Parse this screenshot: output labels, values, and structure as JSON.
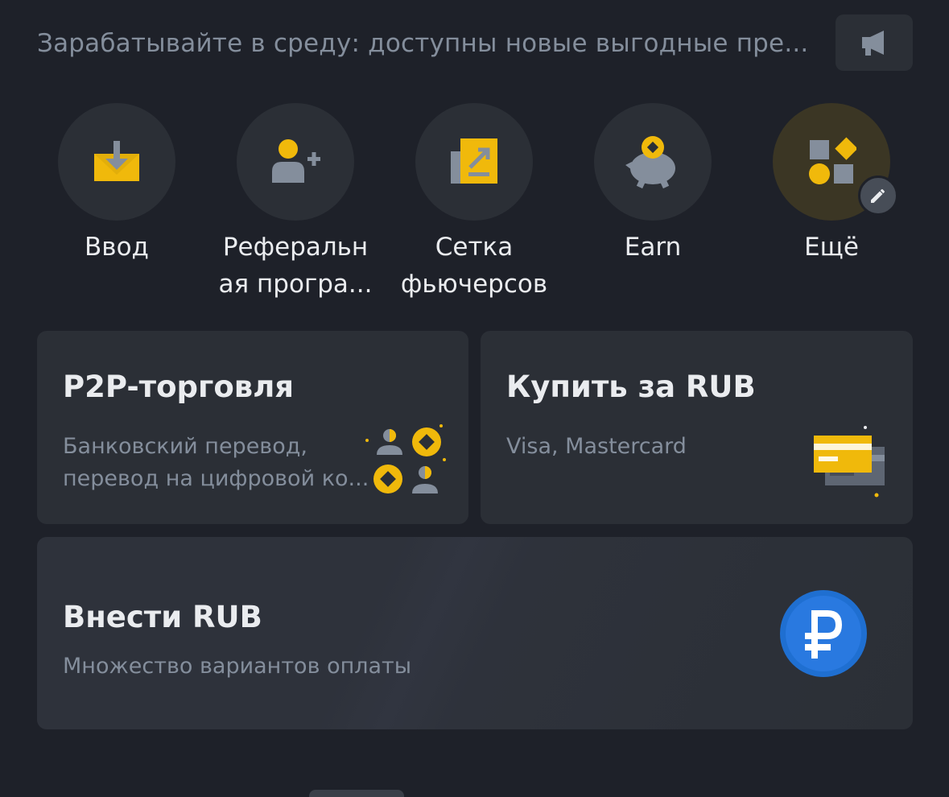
{
  "announcement": {
    "text": "Зарабатывайте в среду: доступны новые выгодные пре...",
    "icon": "megaphone-icon"
  },
  "shortcuts": [
    {
      "label": "Ввод",
      "icon": "deposit-icon"
    },
    {
      "label": "Реферальн\nая програ...",
      "icon": "referral-icon"
    },
    {
      "label": "Сетка\nфьючерсов",
      "icon": "futures-grid-icon"
    },
    {
      "label": "Earn",
      "icon": "earn-piggy-icon"
    },
    {
      "label": "Ещё",
      "icon": "more-icon"
    }
  ],
  "cards": {
    "p2p": {
      "title": "P2P-торговля",
      "sub1": "Банковский перевод,",
      "sub2": "перевод на цифровой ко..."
    },
    "buy": {
      "title": "Купить за RUB",
      "sub1": "Visa, Mastercard"
    },
    "deposit": {
      "title": "Внести RUB",
      "sub1": "Множество вариантов оплаты"
    }
  },
  "colors": {
    "background": "#1e2129",
    "card": "#2b2f36",
    "accent": "#f0b90b",
    "text_primary": "#eaecef",
    "text_secondary": "#848e9c",
    "ruble_blue": "#1f6fd1"
  }
}
